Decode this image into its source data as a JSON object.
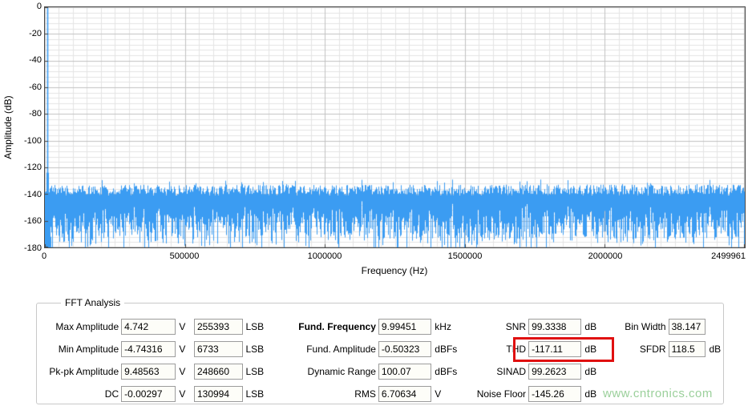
{
  "chart": {
    "y_axis_title": "Amplitude (dB)",
    "x_axis_title": "Frequency (Hz)",
    "y_ticks": [
      "0",
      "-20",
      "-40",
      "-60",
      "-80",
      "-100",
      "-120",
      "-140",
      "-160",
      "-180"
    ],
    "x_ticks": [
      {
        "value": 0,
        "label": "0"
      },
      {
        "value": 500000,
        "label": "500000"
      },
      {
        "value": 1000000,
        "label": "1000000"
      },
      {
        "value": 1500000,
        "label": "1500000"
      },
      {
        "value": 2000000,
        "label": "2000000"
      },
      {
        "value": 2499961,
        "label": "2499961"
      }
    ],
    "chart_data": {
      "type": "line",
      "title": "FFT spectrum",
      "xlabel": "Frequency (Hz)",
      "ylabel": "Amplitude (dB)",
      "xmin": 0,
      "xmax": 2499961,
      "ymin": -180,
      "ymax": 0,
      "x_major_ticks": [
        0,
        500000,
        1000000,
        1500000,
        2000000,
        2499961
      ],
      "y_major_ticks": [
        0,
        -20,
        -40,
        -60,
        -80,
        -100,
        -120,
        -140,
        -160,
        -180
      ],
      "x_minor_step": 50000,
      "y_minor_step": 4,
      "grid": true,
      "color": "#3b9cf2",
      "fundamental_hz": 9994.51,
      "fundamental_db": -0.50323,
      "noise_band_top_db": -136,
      "noise_band_bottom_db": -165,
      "noise_floor_db": -145.26
    }
  },
  "panel": {
    "title": "FFT Analysis",
    "rows": [
      {
        "l1": "Max Amplitude",
        "v1": "4.742",
        "u1": "V",
        "v2": "255393",
        "u2": "LSB",
        "l2": "Fund. Frequency",
        "v3": "9.99451",
        "u3": "kHz",
        "l3": "SNR",
        "v4": "99.3338",
        "u4": "dB",
        "l4": "Bin Width",
        "v5": "38.147",
        "u5": ""
      },
      {
        "l1": "Min Amplitude",
        "v1": "-4.74316",
        "u1": "V",
        "v2": "6733",
        "u2": "LSB",
        "l2": "Fund. Amplitude",
        "v3": "-0.50323",
        "u3": "dBFs",
        "l3": "THD",
        "v4": "-117.11",
        "u4": "dB",
        "l4": "SFDR",
        "v5": "118.5",
        "u5": "dB"
      },
      {
        "l1": "Pk-pk Amplitude",
        "v1": "9.48563",
        "u1": "V",
        "v2": "248660",
        "u2": "LSB",
        "l2": "Dynamic Range",
        "v3": "100.07",
        "u3": "dBFs",
        "l3": "SINAD",
        "v4": "99.2623",
        "u4": "dB",
        "l4": "",
        "v5": "",
        "u5": ""
      },
      {
        "l1": "DC",
        "v1": "-0.00297",
        "u1": "V",
        "v2": "130994",
        "u2": "LSB",
        "l2": "RMS",
        "v3": "6.70634",
        "u3": "V",
        "l3": "Noise Floor",
        "v4": "-145.26",
        "u4": "dB",
        "l4": "",
        "v5": "",
        "u5": ""
      }
    ]
  },
  "watermark": "www.cntronics.com"
}
